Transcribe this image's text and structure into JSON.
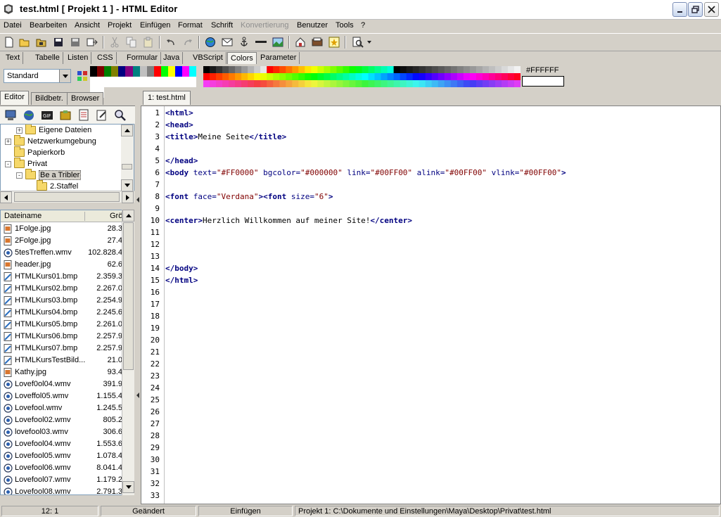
{
  "window": {
    "title": "test.html  [ Projekt 1 ] - HTML Editor"
  },
  "menu": {
    "items": [
      "Datei",
      "Bearbeiten",
      "Ansicht",
      "Projekt",
      "Einfügen",
      "Format",
      "Schrift",
      "Konvertierung",
      "Benutzer",
      "Tools",
      "?"
    ],
    "disabled_item": "Konvertierung"
  },
  "tag_tabs": [
    "Text",
    "Tabelle",
    "Listen",
    "CSS",
    "Formular",
    "Java",
    "VBScript",
    "Colors",
    "Parameter"
  ],
  "active_tag_tab": "Colors",
  "palette": {
    "scheme": "Standard",
    "hex_value": "#FFFFFF",
    "basic_colors": [
      "#000000",
      "#800000",
      "#008000",
      "#808000",
      "#000080",
      "#800080",
      "#008080",
      "#c0c0c0",
      "#808080",
      "#ff0000",
      "#00ff00",
      "#ffff00",
      "#0000ff",
      "#ff00ff",
      "#00ffff",
      "#ffffff",
      "#ffffff",
      "#ffffff",
      "#ffffff",
      "#ffffff",
      "#ffffff",
      "#ffffff",
      "#ffffff",
      "#ffffff",
      "#ffffff",
      "#ffffff",
      "#ffffff",
      "#ffffff",
      "#ffffff",
      "#ffffff",
      "#ffffff",
      "#ffffff"
    ]
  },
  "left_panel": {
    "tabs": [
      "Editor",
      "Bildbetr.",
      "Browser"
    ],
    "active_tab": "Editor",
    "tree": [
      {
        "label": "Eigene Dateien",
        "level": 1,
        "expander": "+"
      },
      {
        "label": "Netzwerkumgebung",
        "level": 0,
        "expander": "+"
      },
      {
        "label": "Papierkorb",
        "level": 0,
        "expander": ""
      },
      {
        "label": "Privat",
        "level": 0,
        "expander": "-"
      },
      {
        "label": "Be a Tribler",
        "level": 1,
        "expander": "-",
        "selected": true
      },
      {
        "label": "2.Staffel",
        "level": 2,
        "expander": ""
      }
    ],
    "file_list": {
      "columns": [
        "Dateiname",
        "Grö"
      ],
      "rows": [
        {
          "name": "1Folge.jpg",
          "size": "28.3",
          "type": "img"
        },
        {
          "name": "2Folge.jpg",
          "size": "27.4",
          "type": "img"
        },
        {
          "name": "5tesTreffen.wmv",
          "size": "102.828.4",
          "type": "wmv"
        },
        {
          "name": "header.jpg",
          "size": "62.6",
          "type": "img"
        },
        {
          "name": "HTMLKurs01.bmp",
          "size": "2.359.3",
          "type": "bmp"
        },
        {
          "name": "HTMLKurs02.bmp",
          "size": "2.267.0",
          "type": "bmp"
        },
        {
          "name": "HTMLKurs03.bmp",
          "size": "2.254.9",
          "type": "bmp"
        },
        {
          "name": "HTMLKurs04.bmp",
          "size": "2.245.6",
          "type": "bmp"
        },
        {
          "name": "HTMLKurs05.bmp",
          "size": "2.261.0",
          "type": "bmp"
        },
        {
          "name": "HTMLKurs06.bmp",
          "size": "2.257.9",
          "type": "bmp"
        },
        {
          "name": "HTMLKurs07.bmp",
          "size": "2.257.9",
          "type": "bmp"
        },
        {
          "name": "HTMLKursTestBild...",
          "size": "21.0",
          "type": "bmp"
        },
        {
          "name": "Kathy.jpg",
          "size": "93.4",
          "type": "img"
        },
        {
          "name": "Lovef0ol04.wmv",
          "size": "391.9",
          "type": "wmv"
        },
        {
          "name": "Loveffol05.wmv",
          "size": "1.155.4",
          "type": "wmv"
        },
        {
          "name": "Lovefool.wmv",
          "size": "1.245.5",
          "type": "wmv"
        },
        {
          "name": "Lovefool02.wmv",
          "size": "805.2",
          "type": "wmv"
        },
        {
          "name": "lovefool03.wmv",
          "size": "306.6",
          "type": "wmv"
        },
        {
          "name": "Lovefool04.wmv",
          "size": "1.553.6",
          "type": "wmv"
        },
        {
          "name": "Lovefool05.wmv",
          "size": "1.078.4",
          "type": "wmv"
        },
        {
          "name": "Lovefool06.wmv",
          "size": "8.041.4",
          "type": "wmv"
        },
        {
          "name": "Lovefool07.wmv",
          "size": "1.179.2",
          "type": "wmv"
        },
        {
          "name": "Lovefool08.wmv",
          "size": "2.791.3",
          "type": "wmv"
        }
      ]
    }
  },
  "editor": {
    "tab_label": "1: test.html",
    "line_count": 33,
    "lines": [
      [
        [
          "tag",
          "<html>"
        ]
      ],
      [
        [
          "tag",
          "<head>"
        ]
      ],
      [
        [
          "tag",
          "<title>"
        ],
        [
          "plain",
          "Meine Seite"
        ],
        [
          "tag",
          "</title>"
        ]
      ],
      [],
      [
        [
          "tag",
          "</head>"
        ]
      ],
      [
        [
          "tag",
          "<body"
        ],
        [
          "attr",
          " text="
        ],
        [
          "val",
          "\"#FF0000\""
        ],
        [
          "attr",
          " bgcolor="
        ],
        [
          "val",
          "\"#000000\""
        ],
        [
          "attr",
          " link="
        ],
        [
          "val",
          "\"#00FF00\""
        ],
        [
          "attr",
          " alink="
        ],
        [
          "val",
          "\"#00FF00\""
        ],
        [
          "attr",
          " vlink="
        ],
        [
          "val",
          "\"#00FF00\""
        ],
        [
          "tag",
          ">"
        ]
      ],
      [],
      [
        [
          "tag",
          "<font"
        ],
        [
          "attr",
          " face="
        ],
        [
          "val",
          "\"Verdana\""
        ],
        [
          "tag",
          ">"
        ],
        [
          "tag",
          "<font"
        ],
        [
          "attr",
          " size="
        ],
        [
          "val",
          "\"6\""
        ],
        [
          "tag",
          ">"
        ]
      ],
      [],
      [
        [
          "tag",
          "<center>"
        ],
        [
          "plain",
          "Herzlich Willkommen auf meiner Site!"
        ],
        [
          "tag",
          "</center>"
        ]
      ],
      [],
      [],
      [],
      [
        [
          "tag",
          "</body>"
        ]
      ],
      [
        [
          "tag",
          "</html>"
        ]
      ]
    ]
  },
  "status": {
    "position": "12: 1",
    "modified": "Geändert",
    "mode": "Einfügen",
    "path": "Projekt 1: C:\\Dokumente und Einstellungen\\Maya\\Desktop\\Privat\\test.html"
  }
}
